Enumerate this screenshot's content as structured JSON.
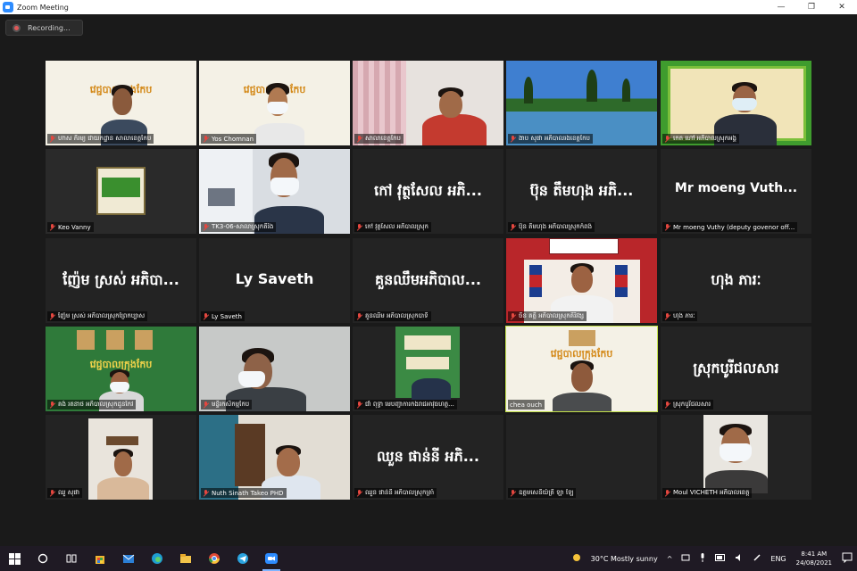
{
  "window": {
    "title": "Zoom Meeting",
    "controls": [
      "—",
      "❐",
      "✕"
    ]
  },
  "recording": {
    "label": "Recording..."
  },
  "tiles": [
    {
      "name": "ហាស ភិរម្យ ជាយកដ្ឋាន សាលាខេត្តកែប",
      "kind": "video",
      "big": ""
    },
    {
      "name": "Yos Chomnan",
      "kind": "video",
      "big": ""
    },
    {
      "name": "សាលាខេត្តកែប",
      "kind": "video",
      "big": ""
    },
    {
      "name": "ងាប សុផា អភិបាលរងខេត្តកែប",
      "kind": "video",
      "big": ""
    },
    {
      "name": "កេត ហៅ អភិបាលស្រុកអង្គ",
      "kind": "video",
      "big": ""
    },
    {
      "name": "Keo Vanny",
      "kind": "video",
      "big": ""
    },
    {
      "name": "TK3-06-សាលាស្រុកតិរំង",
      "kind": "video",
      "big": ""
    },
    {
      "name": "កៅ វុត្ថសែល អភិបាលស្រុក",
      "kind": "text",
      "big": "កៅ វុត្ថសែល អភិ..."
    },
    {
      "name": "ប៊ុន តឹមហុង អភិបាលស្រុកកំពង់",
      "kind": "text",
      "big": "ប៊ុន តឹមហុង អភិ..."
    },
    {
      "name": "Mr moeng Vuthy (deputy govenor off...",
      "kind": "text",
      "big": "Mr moeng Vuth..."
    },
    {
      "name": "ញ៉ែម ស្រស់ អភិបាលស្រុកព្រៃកប្បាស",
      "kind": "text",
      "big": "ញ៉ែម ស្រស់ អភិបា..."
    },
    {
      "name": "Ly Saveth",
      "kind": "text",
      "big": "Ly Saveth"
    },
    {
      "name": "គួនឈឹម អភិបាលស្រុកបាទី",
      "kind": "text",
      "big": "គួនឈឹមអភិបាល..."
    },
    {
      "name": "ចិន គត្តិ អភិបាលស្រុកគិរីវង្ស",
      "kind": "video",
      "big": ""
    },
    {
      "name": "ហុង ភារៈ",
      "kind": "text",
      "big": "ហុង ភារៈ"
    },
    {
      "name": "គង់ រតនាថ អភិបាលស្រុកដូនកែវ",
      "kind": "video",
      "big": ""
    },
    {
      "name": "មន្ទីរកសិកម្មកែប",
      "kind": "video",
      "big": ""
    },
    {
      "name": "ជាំ ពុទ្ធា មេបញ្ជាការកងរាជអាវុធហត្ថ...",
      "kind": "video",
      "big": ""
    },
    {
      "name": "chea ouch",
      "kind": "video",
      "big": ""
    },
    {
      "name": "ស្រុកបូរីជលសារ",
      "kind": "text",
      "big": "ស្រុកបូរីជលសារ"
    },
    {
      "name": "ឈួ សុផា",
      "kind": "video",
      "big": ""
    },
    {
      "name": "Nuth Sinath Takeo PHD",
      "kind": "video",
      "big": ""
    },
    {
      "name": "ឈួន ផាន់នី អភិបាលស្រុកត្រាំ",
      "kind": "text",
      "big": "ឈួន ផាន់នី អភិ..."
    },
    {
      "name": "ឧត្តមសេនីយ៍ត្រី ឡា ឡៃ",
      "kind": "text",
      "big": ""
    },
    {
      "name": "Moul VICHETH អភិបាលខេត្ត",
      "kind": "video",
      "big": ""
    }
  ],
  "banner": {
    "text": "វេជ្ជបាលក្រុងកែប"
  },
  "taskbar": {
    "weather": "30°C  Mostly sunny",
    "lang": "ENG",
    "time": "8:41 AM",
    "date": "24/08/2021",
    "icons": [
      "windows-start",
      "search",
      "task-view",
      "store",
      "mail",
      "edge",
      "file-explorer",
      "chrome",
      "telegram",
      "zoom"
    ]
  },
  "colors": {
    "speaking": "#c3e14a",
    "muted": "#e4473f",
    "banner_gold": "#d48a1a",
    "green": "#3f9c2e"
  }
}
